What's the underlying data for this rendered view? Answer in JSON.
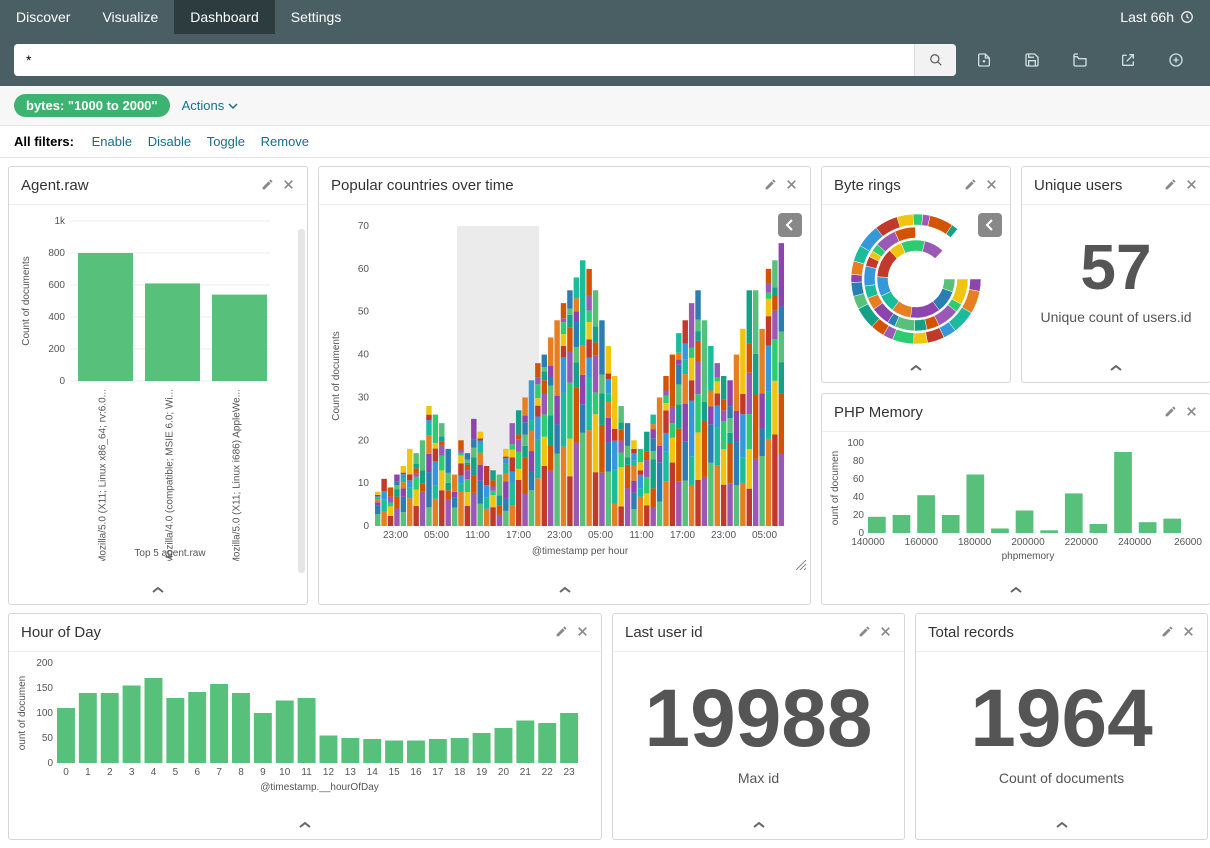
{
  "nav": {
    "tabs": [
      "Discover",
      "Visualize",
      "Dashboard",
      "Settings"
    ],
    "active": 2,
    "time_label": "Last 66h"
  },
  "toolbar": {
    "search_value": "*"
  },
  "filter": {
    "pill": "bytes: \"1000 to 2000\"",
    "actions_label": "Actions",
    "all_filters_label": "All filters:",
    "links": [
      "Enable",
      "Disable",
      "Toggle",
      "Remove"
    ]
  },
  "panels": {
    "agent": {
      "title": "Agent.raw",
      "ylabel": "Count of documents",
      "xlabel": "Top 5 agent.raw"
    },
    "countries": {
      "title": "Popular countries over time",
      "ylabel": "Count of documents",
      "xlabel": "@timestamp per hour"
    },
    "byterings": {
      "title": "Byte rings"
    },
    "unique": {
      "title": "Unique users",
      "value": "57",
      "sub": "Unique count of users.id"
    },
    "php": {
      "title": "PHP Memory",
      "ylabel": "ount of documen",
      "xlabel": "phpmemory"
    },
    "hour": {
      "title": "Hour of Day",
      "ylabel": "ount of documen",
      "xlabel": "@timestamp.__hourOfDay"
    },
    "lastuser": {
      "title": "Last user id",
      "value": "19988",
      "sub": "Max id"
    },
    "total": {
      "title": "Total records",
      "value": "1964",
      "sub": "Count of documents"
    }
  },
  "chart_data": [
    {
      "id": "agent",
      "type": "bar",
      "categories": [
        "Mozilla/5.0 (X11; Linux x86_64; rv:6.0...",
        "Mozilla/4.0 (compatible; MSIE 6.0; Wi...",
        "Mozilla/5.0 (X11; Linux i686) AppleWe..."
      ],
      "values": [
        800,
        610,
        540
      ],
      "yticks": [
        0,
        200,
        400,
        600,
        800,
        "1k"
      ],
      "ylim": [
        0,
        1000
      ],
      "ylabel": "Count of documents",
      "xlabel": "Top 5 agent.raw"
    },
    {
      "id": "countries",
      "type": "bar",
      "stacked": true,
      "xticks": [
        "23:00",
        "05:00",
        "11:00",
        "17:00",
        "23:00",
        "05:00",
        "11:00",
        "17:00",
        "23:00",
        "05:00"
      ],
      "yticks": [
        0,
        10,
        20,
        30,
        40,
        50,
        60,
        70
      ],
      "ylim": [
        0,
        70
      ],
      "ylabel": "Count of documents",
      "xlabel": "@timestamp per hour",
      "n_bars": 64,
      "brush": {
        "start_frac": 0.2,
        "end_frac": 0.4
      },
      "totals": [
        8,
        11,
        9,
        12,
        14,
        18,
        17,
        20,
        28,
        26,
        24,
        18,
        12,
        20,
        17,
        25,
        22,
        14,
        13,
        12,
        18,
        24,
        27,
        30,
        34,
        38,
        40,
        44,
        48,
        52,
        55,
        58,
        62,
        60,
        55,
        48,
        42,
        35,
        28,
        24,
        20,
        18,
        22,
        26,
        30,
        35,
        40,
        45,
        48,
        52,
        55,
        48,
        42,
        38,
        35,
        34,
        40,
        46,
        55,
        55,
        46,
        60,
        62,
        66
      ],
      "breakdown_note": "stacked segments per country; proportions estimated"
    },
    {
      "id": "byterings",
      "type": "pie",
      "variant": "concentric-donut",
      "rings": 3,
      "note": "multi-ring donut with many colored segments per ring; exact values not labeled"
    },
    {
      "id": "php",
      "type": "bar",
      "categories": [
        "140000",
        "160000",
        "180000",
        "200000",
        "220000",
        "240000",
        "26000"
      ],
      "series_x": [
        140000,
        150000,
        160000,
        170000,
        180000,
        190000,
        200000,
        210000,
        220000,
        230000,
        240000,
        250000,
        260000
      ],
      "values": [
        18,
        20,
        42,
        20,
        65,
        5,
        25,
        3,
        44,
        10,
        90,
        12,
        16
      ],
      "yticks": [
        0,
        20,
        40,
        60,
        80,
        100
      ],
      "ylim": [
        0,
        100
      ],
      "ylabel": "ount of documen",
      "xlabel": "phpmemory"
    },
    {
      "id": "hour",
      "type": "bar",
      "categories": [
        "0",
        "1",
        "2",
        "3",
        "4",
        "5",
        "6",
        "7",
        "8",
        "9",
        "10",
        "11",
        "12",
        "13",
        "14",
        "15",
        "16",
        "17",
        "18",
        "19",
        "20",
        "21",
        "22",
        "23"
      ],
      "values": [
        110,
        140,
        140,
        155,
        170,
        130,
        142,
        158,
        140,
        100,
        125,
        130,
        55,
        50,
        48,
        45,
        45,
        48,
        50,
        60,
        70,
        85,
        80,
        100
      ],
      "yticks": [
        0,
        50,
        100,
        150,
        200
      ],
      "ylim": [
        0,
        200
      ],
      "ylabel": "ount of documen",
      "xlabel": "@timestamp.__hourOfDay"
    }
  ],
  "colors": {
    "bar_green": "#57c17b",
    "stack_palette": [
      "#57c17b",
      "#2b7eb1",
      "#8e44ad",
      "#e67e22",
      "#1abc9c",
      "#3498db",
      "#c0392b",
      "#f1c40f",
      "#2ecc71",
      "#9b59b6",
      "#d35400",
      "#16a085"
    ]
  }
}
